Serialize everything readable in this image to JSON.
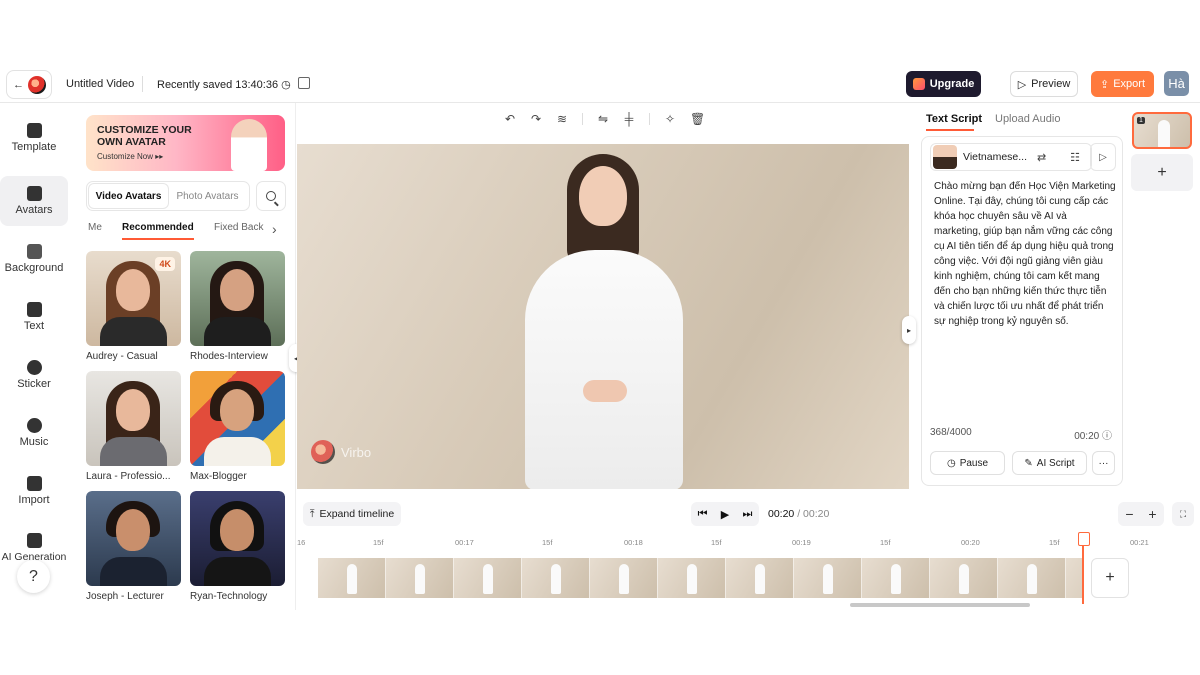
{
  "header": {
    "title": "Untitled Video",
    "saved": "Recently saved 13:40:36",
    "upgrade_label": "Upgrade",
    "preview_label": "Preview",
    "export_label": "Export",
    "user_initials": "Hà"
  },
  "rail": {
    "items": [
      {
        "label": "Template",
        "icon": "template-icon"
      },
      {
        "label": "Avatars",
        "icon": "avatar-icon",
        "active": true
      },
      {
        "label": "Background",
        "icon": "background-icon"
      },
      {
        "label": "Text",
        "icon": "text-icon"
      },
      {
        "label": "Sticker",
        "icon": "sticker-icon"
      },
      {
        "label": "Music",
        "icon": "music-icon"
      },
      {
        "label": "Import",
        "icon": "import-icon"
      },
      {
        "label": "AI Generation",
        "icon": "ai-generation-icon"
      }
    ],
    "help_label": "?"
  },
  "panel": {
    "banner": {
      "title": "CUSTOMIZE YOUR OWN AVATAR",
      "cta": "Customize Now ▸▸"
    },
    "tabs": [
      "Video Avatars",
      "Photo Avatars"
    ],
    "filters": [
      "Me",
      "Recommended",
      "Fixed Back"
    ],
    "avatars": [
      {
        "name": "Audrey - Casual",
        "badge": "4K"
      },
      {
        "name": "Rhodes-Interview",
        "badge": ""
      },
      {
        "name": "Laura - Professio...",
        "badge": ""
      },
      {
        "name": "Max-Blogger",
        "badge": ""
      },
      {
        "name": "Joseph - Lecturer",
        "badge": ""
      },
      {
        "name": "Ryan-Technology",
        "badge": ""
      }
    ]
  },
  "canvas": {
    "watermark": "Virbo"
  },
  "script": {
    "tabs": [
      "Text Script",
      "Upload Audio"
    ],
    "voice": "Vietnamese...",
    "text": "Chào mừng bạn đến Học Viện Marketing Online. Tại đây, chúng tôi cung cấp các khóa học chuyên sâu về AI và marketing, giúp bạn nắm vững các công cụ AI tiên tiến để áp dụng hiệu quả trong công việc. Với đội ngũ giảng viên giàu kinh nghiệm, chúng tôi cam kết mang đến cho bạn những kiến thức thực tiễn và chiến lược tối ưu nhất để phát triển sự nghiệp trong kỷ nguyên số.",
    "char_count": "368/4000",
    "duration": "00:20",
    "pause_label": "Pause",
    "ai_script_label": "AI Script",
    "more_label": "···"
  },
  "scenes": {
    "current_number": "1",
    "add_label": "+"
  },
  "timeline": {
    "expand_label": "Expand timeline",
    "current_time": "00:20",
    "total_time": "/ 00:20",
    "ruler": [
      "16",
      "15f",
      "00:17",
      "15f",
      "00:18",
      "15f",
      "00:19",
      "15f",
      "00:20",
      "15f",
      "00:21"
    ]
  }
}
